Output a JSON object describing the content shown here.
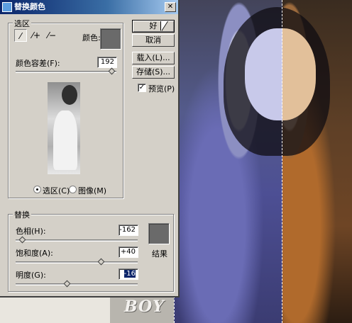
{
  "dialog": {
    "title": "替换颜色",
    "close_glyph": "✕"
  },
  "selection_group": {
    "label": "选区",
    "color_label": "颜色:",
    "fuzziness_label": "颜色容差(F):",
    "fuzziness_value": "192",
    "fuzziness_level": 0.95,
    "radio_selection": "选区(C)",
    "radio_image": "图像(M)",
    "selected_radio": "selection",
    "tools": [
      {
        "name": "eyedropper-icon",
        "glyph": "⁄"
      },
      {
        "name": "eyedropper-plus-icon",
        "glyph": "⁄+"
      },
      {
        "name": "eyedropper-minus-icon",
        "glyph": "⁄−"
      }
    ],
    "swatch_color": "#6a6a6a"
  },
  "buttons": {
    "ok": "好",
    "cancel": "取消",
    "load": "载入(L)...",
    "save": "存储(S)...",
    "preview_label": "预览(P)",
    "preview_checked": "✓"
  },
  "replace_group": {
    "label": "替换",
    "hue_label": "色相(H):",
    "hue_value": "-162",
    "hue_level": 0.05,
    "saturation_label": "饱和度(A):",
    "saturation_value": "+40",
    "saturation_level": 0.7,
    "lightness_label": "明度(G):",
    "lightness_value": "-16",
    "lightness_level": 0.42,
    "result_label": "结果",
    "result_color": "#6a6a6a"
  },
  "background": {
    "logo_text": "BOY"
  }
}
